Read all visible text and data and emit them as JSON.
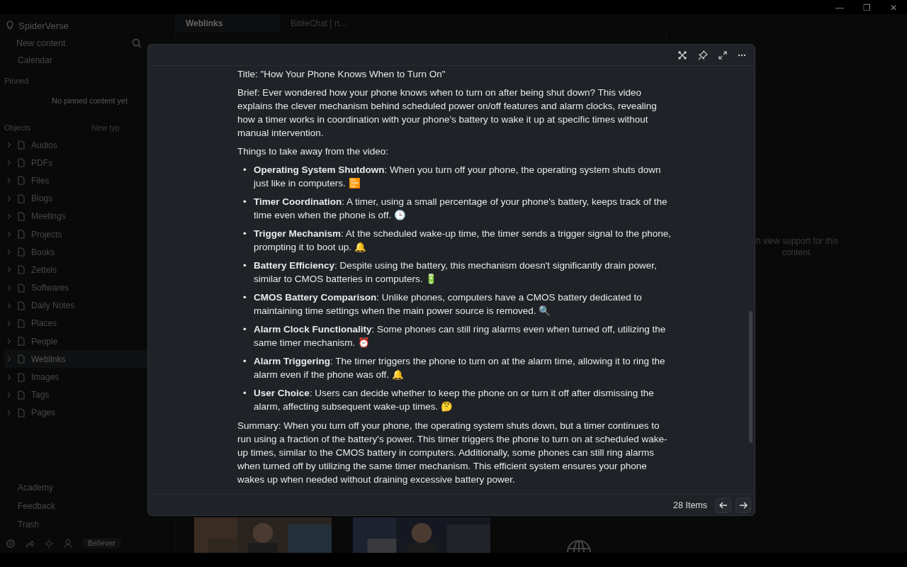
{
  "window_controls": [
    "—",
    "❐",
    "✕"
  ],
  "sidebar": {
    "space": "SpiderVerse",
    "new_content": "New content",
    "calendar": "Calendar",
    "pinned_heading": "Pinned",
    "pinned_empty": "No pinned content yet",
    "objects_heading": "Objects",
    "new_type": "New typ",
    "items": [
      {
        "label": "Audios",
        "selected": false
      },
      {
        "label": "PDFs",
        "selected": false
      },
      {
        "label": "Files",
        "selected": false
      },
      {
        "label": "Blogs",
        "selected": false
      },
      {
        "label": "Meetings",
        "selected": false
      },
      {
        "label": "Projects",
        "selected": false
      },
      {
        "label": "Books",
        "selected": false
      },
      {
        "label": "Zettels",
        "selected": false
      },
      {
        "label": "Softwares",
        "selected": false
      },
      {
        "label": "Daily Notes",
        "selected": false
      },
      {
        "label": "Places",
        "selected": false
      },
      {
        "label": "People",
        "selected": false
      },
      {
        "label": "Weblinks",
        "selected": true
      },
      {
        "label": "Images",
        "selected": false
      },
      {
        "label": "Tags",
        "selected": false
      },
      {
        "label": "Pages",
        "selected": false
      }
    ],
    "footer": [
      "Academy",
      "Feedback",
      "Trash"
    ],
    "plan": "Believer"
  },
  "tabs": [
    {
      "label": "Weblinks",
      "selected": true
    },
    {
      "label": "BibleChat [ n...",
      "selected": false
    }
  ],
  "graph_panel": {
    "message": "h view support for this content."
  },
  "modal": {
    "paragraphs_top": [
      "Title: \"How Your Phone Knows When to Turn On\"",
      "Brief: Ever wondered how your phone knows when to turn on after being shut down? This video explains the clever mechanism behind scheduled power on/off features and alarm clocks, revealing how a timer works in coordination with your phone's battery to wake it up at specific times without manual intervention.",
      "Things to take away from the video:"
    ],
    "bullets": [
      "**Operating System Shutdown**: When you turn off your phone, the operating system shuts down just like in computers. 📴",
      "**Timer Coordination**: A timer, using a small percentage of your phone's battery, keeps track of the time even when the phone is off. 🕒",
      "**Trigger Mechanism**: At the scheduled wake-up time, the timer sends a trigger signal to the phone, prompting it to boot up. 🔔",
      "**Battery Efficiency**: Despite using the battery, this mechanism doesn't significantly drain power, similar to CMOS batteries in computers. 🔋",
      "**CMOS Battery Comparison**: Unlike phones, computers have a CMOS battery dedicated to maintaining time settings when the main power source is removed. 🔍",
      "**Alarm Clock Functionality**: Some phones can still ring alarms even when turned off, utilizing the same timer mechanism. ⏰",
      "**Alarm Triggering**: The timer triggers the phone to turn on at the alarm time, allowing it to ring the alarm even if the phone was off. 🔔",
      "**User Choice**: Users can decide whether to keep the phone on or turn it off after dismissing the alarm, affecting subsequent wake-up times. 🤔"
    ],
    "summary": "Summary: When you turn off your phone, the operating system shuts down, but a timer continues to run using a fraction of the battery's power. This timer triggers the phone to turn on at scheduled wake-up times, similar to the CMOS battery in computers. Additionally, some phones can still ring alarms when turned off by utilizing the same timer mechanism. This efficient system ensures your phone wakes up when needed without draining excessive battery power.",
    "bullet_marker": "•",
    "count": "28 Items"
  },
  "thumbnails": [
    {
      "kind": "picture"
    },
    {
      "kind": "picture"
    },
    {
      "kind": "globe"
    }
  ]
}
